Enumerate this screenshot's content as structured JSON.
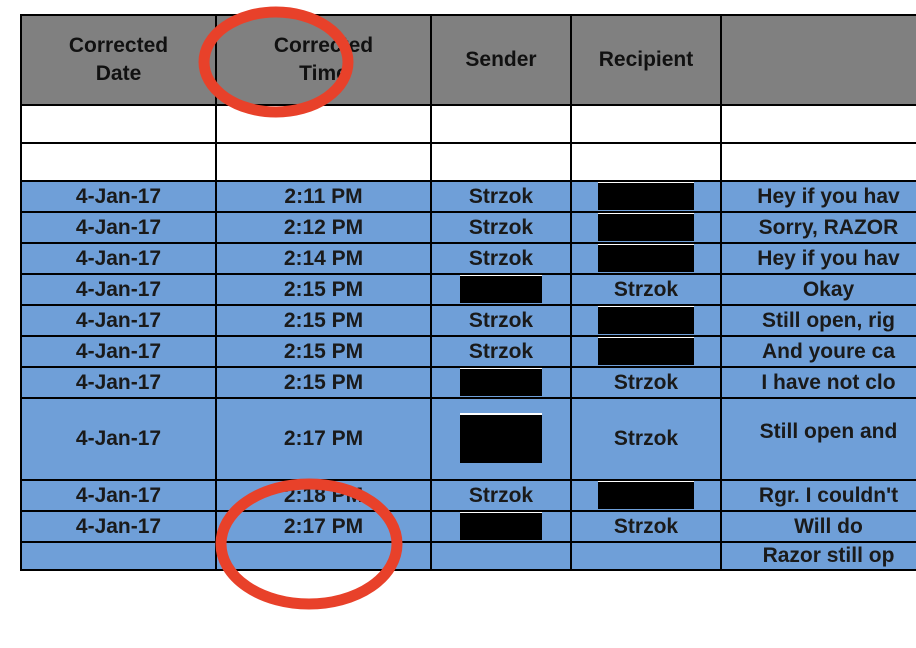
{
  "document": {
    "type": "spreadsheet-table",
    "colors": {
      "header_background": "#808080",
      "row_background": "#6f9fd8",
      "blank_row_background": "#ffffff",
      "grid_line": "#000000",
      "annotation": "#E8412A",
      "redaction": "#000000"
    }
  },
  "table": {
    "columns": [
      {
        "id": "corrected_date",
        "label_line1": "Corrected",
        "label_line2": "Date"
      },
      {
        "id": "corrected_time",
        "label_line1": "Corrected",
        "label_line2": "Time"
      },
      {
        "id": "sender",
        "label_line1": "Sender",
        "label_line2": ""
      },
      {
        "id": "recipient",
        "label_line1": "Recipient",
        "label_line2": ""
      },
      {
        "id": "message",
        "label_line1": "",
        "label_line2": ""
      }
    ],
    "blank_rows": 2,
    "rows": [
      {
        "date": "4-Jan-17",
        "time": "2:11 PM",
        "sender": "Strzok",
        "recipient": "[REDACTED]",
        "recipient_redacted": true,
        "sender_redacted": false,
        "message": "Hey if you hav"
      },
      {
        "date": "4-Jan-17",
        "time": "2:12 PM",
        "sender": "Strzok",
        "recipient": "[REDACTED]",
        "recipient_redacted": true,
        "sender_redacted": false,
        "message": "Sorry, RAZOR"
      },
      {
        "date": "4-Jan-17",
        "time": "2:14 PM",
        "sender": "Strzok",
        "recipient": "[REDACTED]",
        "recipient_redacted": true,
        "sender_redacted": false,
        "message": "Hey if you hav"
      },
      {
        "date": "4-Jan-17",
        "time": "2:15 PM",
        "sender": "[REDACTED]",
        "recipient": "Strzok",
        "recipient_redacted": false,
        "sender_redacted": true,
        "message": "Okay"
      },
      {
        "date": "4-Jan-17",
        "time": "2:15 PM",
        "sender": "Strzok",
        "recipient": "[REDACTED]",
        "recipient_redacted": true,
        "sender_redacted": false,
        "message": "Still open, rig"
      },
      {
        "date": "4-Jan-17",
        "time": "2:15 PM",
        "sender": "Strzok",
        "recipient": "[REDACTED]",
        "recipient_redacted": true,
        "sender_redacted": false,
        "message": "And youre ca"
      },
      {
        "date": "4-Jan-17",
        "time": "2:15 PM",
        "sender": "[REDACTED]",
        "recipient": "Strzok",
        "recipient_redacted": false,
        "sender_redacted": true,
        "message": "I have not clo"
      },
      {
        "date": "4-Jan-17",
        "time": "2:17 PM",
        "sender": "[REDACTED]",
        "recipient": "Strzok",
        "recipient_redacted": false,
        "sender_redacted": true,
        "message": "Still open and",
        "tall": true
      },
      {
        "date": "4-Jan-17",
        "time": "2:18 PM",
        "sender": "Strzok",
        "recipient": "[REDACTED]",
        "recipient_redacted": true,
        "sender_redacted": false,
        "message": "Rgr. I couldn't"
      },
      {
        "date": "4-Jan-17",
        "time": "2:17 PM",
        "sender": "[REDACTED]",
        "recipient": "Strzok",
        "recipient_redacted": false,
        "sender_redacted": true,
        "message": "Will do"
      },
      {
        "date": "",
        "time": "",
        "sender": "",
        "recipient": "",
        "recipient_redacted": false,
        "sender_redacted": false,
        "message": "Razor still op",
        "partial": true
      }
    ]
  },
  "annotations": [
    {
      "id": "ellipse-corrected-time-header",
      "shape": "ellipse",
      "target": "Corrected Time column header"
    },
    {
      "id": "ellipse-time-values",
      "shape": "ellipse",
      "target": "2:17 PM / 2:18 PM / 2:17 PM time values"
    }
  ]
}
